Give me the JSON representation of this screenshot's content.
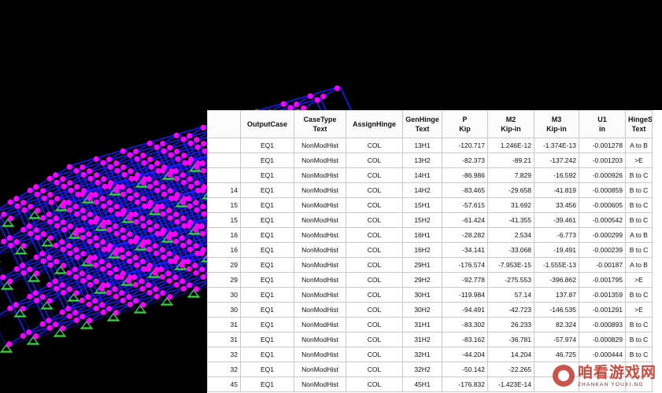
{
  "colors": {
    "background": "#000000",
    "frame": "#1a1aff",
    "frame_dark": "#0c0ca8",
    "hinge": "#ff00ff",
    "support": "#33dd33",
    "table_bg": "#ffffff",
    "grid": "#c9c9c9"
  },
  "icons": {
    "hinge_marker": "hinge-dot-icon",
    "support_marker": "fixed-support-icon",
    "watermark_logo": "watermark-logo-icon"
  },
  "table": {
    "columns": [
      {
        "name": "OutputCase",
        "unit": ""
      },
      {
        "name": "CaseType",
        "unit": "Text"
      },
      {
        "name": "AssignHinge",
        "unit": ""
      },
      {
        "name": "GenHinge",
        "unit": "Text"
      },
      {
        "name": "P",
        "unit": "Kip"
      },
      {
        "name": "M2",
        "unit": "Kip-in"
      },
      {
        "name": "M3",
        "unit": "Kip-in"
      },
      {
        "name": "U1",
        "unit": "in"
      },
      {
        "name": "HingeState",
        "unit": "Text"
      }
    ],
    "rows": [
      {
        "frame": "",
        "output_case": "EQ1",
        "case_type": "NonModHist",
        "assign_hinge": "COL",
        "gen_hinge": "13H1",
        "p": "-120.717",
        "m2": "1.246E-12",
        "m3": "-1.374E-13",
        "u1": "-0.001278",
        "hinge_state": "A to B"
      },
      {
        "frame": "",
        "output_case": "EQ1",
        "case_type": "NonModHist",
        "assign_hinge": "COL",
        "gen_hinge": "13H2",
        "p": "-82.373",
        "m2": "-89.21",
        "m3": "-137.242",
        "u1": "-0.001203",
        "hinge_state": ">E"
      },
      {
        "frame": "",
        "output_case": "EQ1",
        "case_type": "NonModHist",
        "assign_hinge": "COL",
        "gen_hinge": "14H1",
        "p": "-86.986",
        "m2": "7.829",
        "m3": "-16.592",
        "u1": "-0.000926",
        "hinge_state": "B to C"
      },
      {
        "frame": "14",
        "output_case": "EQ1",
        "case_type": "NonModHist",
        "assign_hinge": "COL",
        "gen_hinge": "14H2",
        "p": "-83.465",
        "m2": "-29.658",
        "m3": "-41.819",
        "u1": "-0.000859",
        "hinge_state": "B to C"
      },
      {
        "frame": "15",
        "output_case": "EQ1",
        "case_type": "NonModHist",
        "assign_hinge": "COL",
        "gen_hinge": "15H1",
        "p": "-57.615",
        "m2": "31.692",
        "m3": "33.456",
        "u1": "-0.000605",
        "hinge_state": "B to C"
      },
      {
        "frame": "15",
        "output_case": "EQ1",
        "case_type": "NonModHist",
        "assign_hinge": "COL",
        "gen_hinge": "15H2",
        "p": "-61.424",
        "m2": "-41.355",
        "m3": "-39.461",
        "u1": "-0.000542",
        "hinge_state": "B to C"
      },
      {
        "frame": "16",
        "output_case": "EQ1",
        "case_type": "NonModHist",
        "assign_hinge": "COL",
        "gen_hinge": "16H1",
        "p": "-28.282",
        "m2": "2.534",
        "m3": "-6.773",
        "u1": "-0.000299",
        "hinge_state": "A to B"
      },
      {
        "frame": "16",
        "output_case": "EQ1",
        "case_type": "NonModHist",
        "assign_hinge": "COL",
        "gen_hinge": "16H2",
        "p": "-34.141",
        "m2": "-33.068",
        "m3": "-19.491",
        "u1": "-0.000239",
        "hinge_state": "B to C"
      },
      {
        "frame": "29",
        "output_case": "EQ1",
        "case_type": "NonModHist",
        "assign_hinge": "COL",
        "gen_hinge": "29H1",
        "p": "-176.574",
        "m2": "-7.953E-15",
        "m3": "-1.555E-13",
        "u1": "-0.00187",
        "hinge_state": "A to B"
      },
      {
        "frame": "29",
        "output_case": "EQ1",
        "case_type": "NonModHist",
        "assign_hinge": "COL",
        "gen_hinge": "29H2",
        "p": "-92.778",
        "m2": "-275.553",
        "m3": "-396.862",
        "u1": "-0.001795",
        "hinge_state": ">E"
      },
      {
        "frame": "30",
        "output_case": "EQ1",
        "case_type": "NonModHist",
        "assign_hinge": "COL",
        "gen_hinge": "30H1",
        "p": "-119.984",
        "m2": "57.14",
        "m3": "137.87",
        "u1": "-0.001359",
        "hinge_state": "B to C"
      },
      {
        "frame": "30",
        "output_case": "EQ1",
        "case_type": "NonModHist",
        "assign_hinge": "COL",
        "gen_hinge": "30H2",
        "p": "-94.491",
        "m2": "-42.723",
        "m3": "-146.535",
        "u1": "-0.001291",
        "hinge_state": ">E"
      },
      {
        "frame": "31",
        "output_case": "EQ1",
        "case_type": "NonModHist",
        "assign_hinge": "COL",
        "gen_hinge": "31H1",
        "p": "-83.302",
        "m2": "26.233",
        "m3": "82.324",
        "u1": "-0.000893",
        "hinge_state": "B to C"
      },
      {
        "frame": "31",
        "output_case": "EQ1",
        "case_type": "NonModHist",
        "assign_hinge": "COL",
        "gen_hinge": "31H2",
        "p": "-83.162",
        "m2": "-36.781",
        "m3": "-57.974",
        "u1": "-0.000829",
        "hinge_state": "B to C"
      },
      {
        "frame": "32",
        "output_case": "EQ1",
        "case_type": "NonModHist",
        "assign_hinge": "COL",
        "gen_hinge": "32H1",
        "p": "-44.204",
        "m2": "14.204",
        "m3": "46.725",
        "u1": "-0.000444",
        "hinge_state": "B to C"
      },
      {
        "frame": "32",
        "output_case": "EQ1",
        "case_type": "NonModHist",
        "assign_hinge": "COL",
        "gen_hinge": "32H2",
        "p": "-50.142",
        "m2": "-22.265",
        "m3": "",
        "u1": "",
        "hinge_state": ""
      },
      {
        "frame": "45",
        "output_case": "EQ1",
        "case_type": "NonModHist",
        "assign_hinge": "COL",
        "gen_hinge": "45H1",
        "p": "-176.832",
        "m2": "-1.423E-14",
        "m3": "",
        "u1": "",
        "hinge_state": ""
      }
    ]
  },
  "watermark": {
    "title": "咱看游戏网",
    "subtitle": "ZHANKAN YOUXI.NG"
  }
}
